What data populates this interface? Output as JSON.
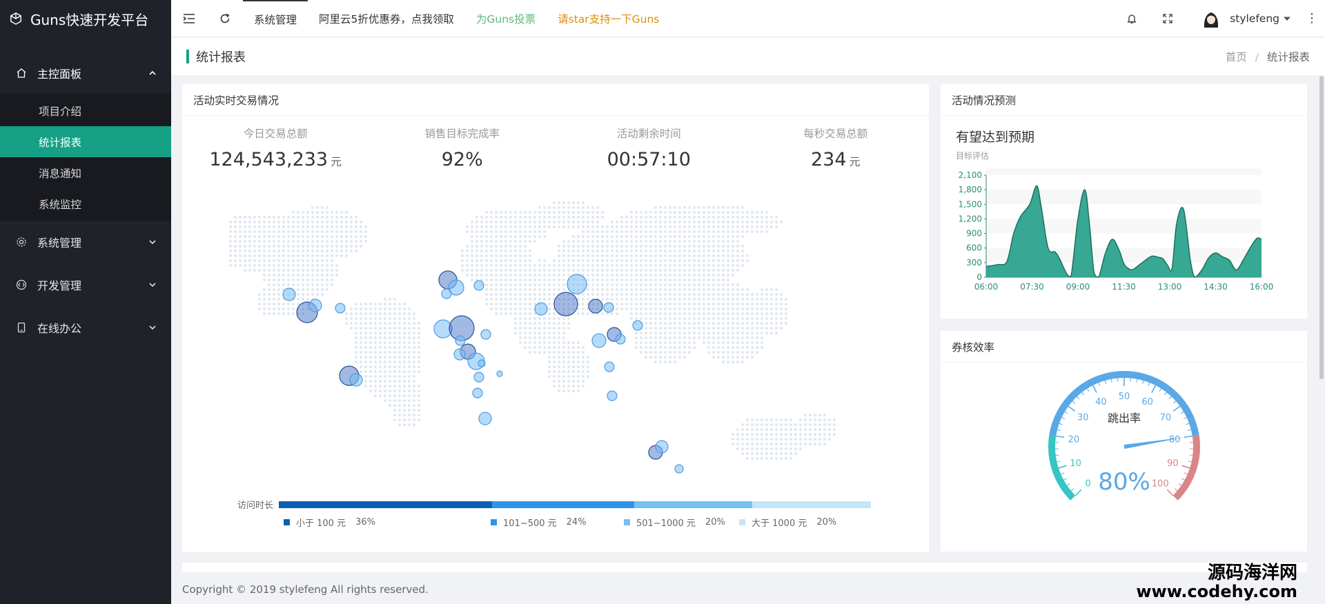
{
  "app": {
    "title": "Guns快速开发平台"
  },
  "sidebar": {
    "groups": [
      {
        "label": "主控面板",
        "items": [
          "项目介绍",
          "统计报表",
          "消息通知",
          "系统监控"
        ]
      },
      {
        "label": "系统管理"
      },
      {
        "label": "开发管理"
      },
      {
        "label": "在线办公"
      }
    ]
  },
  "header": {
    "nav": [
      "系统管理",
      "阿里云5折优惠券，点我领取",
      "为Guns投票",
      "请star支持一下Guns"
    ],
    "user": "stylefeng",
    "more": "⋮"
  },
  "page": {
    "title": "统计报表",
    "breadcrumb": [
      "首页",
      "/",
      "统计报表"
    ]
  },
  "realtime": {
    "title": "活动实时交易情况",
    "stats": [
      {
        "label": "今日交易总额",
        "value": "124,543,233",
        "unit": "元"
      },
      {
        "label": "销售目标完成率",
        "value": "92%",
        "unit": ""
      },
      {
        "label": "活动剩余时间",
        "value": "00:57:10",
        "unit": ""
      },
      {
        "label": "每秒交易总额",
        "value": "234",
        "unit": "元"
      }
    ],
    "legend_title": "访问时长",
    "legend": [
      {
        "label": "小于 100 元",
        "pct": "36%",
        "share": 36,
        "color": "#0d5fb3"
      },
      {
        "label": "101~500 元",
        "pct": "24%",
        "share": 24,
        "color": "#2d95e8"
      },
      {
        "label": "501~1000 元",
        "pct": "20%",
        "share": 20,
        "color": "#74c0f2"
      },
      {
        "label": "大于 1000 元",
        "pct": "20%",
        "share": 20,
        "color": "#c4e6fa"
      }
    ]
  },
  "forecast": {
    "title": "活动情况预测",
    "headline": "有望达到预期",
    "subtitle": "目标评估"
  },
  "chart_data": {
    "type": "area",
    "title": "",
    "xlabel": "",
    "ylabel": "",
    "ylim": [
      0,
      2100
    ],
    "yticks": [
      "0",
      "300",
      "600",
      "900",
      "1,200",
      "1,500",
      "1,800",
      "2,100"
    ],
    "xticks": [
      "06:00",
      "07:30",
      "09:00",
      "11:30",
      "13:00",
      "14:30",
      "16:00"
    ],
    "x": [
      0,
      0.25,
      0.45,
      0.6,
      0.75,
      0.95,
      1.1,
      1.2,
      1.35,
      1.5,
      1.6,
      1.75,
      1.85,
      2,
      2.15,
      2.25,
      2.35,
      2.45,
      2.6,
      2.75,
      2.9,
      3.0,
      3.1,
      3.2,
      3.4,
      3.6,
      3.75,
      3.85,
      3.95,
      4.05,
      4.15,
      4.3,
      4.45,
      4.55,
      4.7,
      4.85,
      5,
      5.15,
      5.3,
      5.45,
      5.6,
      5.75,
      5.9,
      6
    ],
    "values": [
      220,
      260,
      320,
      900,
      1250,
      1500,
      1880,
      1450,
      600,
      520,
      380,
      80,
      20,
      1200,
      1800,
      1100,
      100,
      0,
      500,
      780,
      550,
      280,
      180,
      160,
      300,
      430,
      410,
      380,
      250,
      180,
      1100,
      1400,
      350,
      0,
      150,
      400,
      500,
      420,
      350,
      150,
      350,
      600,
      800,
      780
    ],
    "color": "#2ba38d"
  },
  "gauge": {
    "title": "券核效率",
    "label": "跳出率",
    "value": 80,
    "display": "80%",
    "ticks": [
      "0",
      "10",
      "20",
      "30",
      "40",
      "50",
      "60",
      "70",
      "80",
      "90",
      "100"
    ]
  },
  "footer": {
    "copyright": "Copyright © 2019 stylefeng All rights reserved."
  },
  "watermark": {
    "line1": "源码海洋网",
    "line2": "www.codehy.com"
  },
  "colors": {
    "accent": "#16a085",
    "sidebar": "#20222a",
    "green": "#5fb878",
    "orange": "#e08e0b",
    "gauge_blue": "#5aa8e6",
    "gauge_red": "#d98689",
    "gauge_teal": "#36c4c4"
  }
}
